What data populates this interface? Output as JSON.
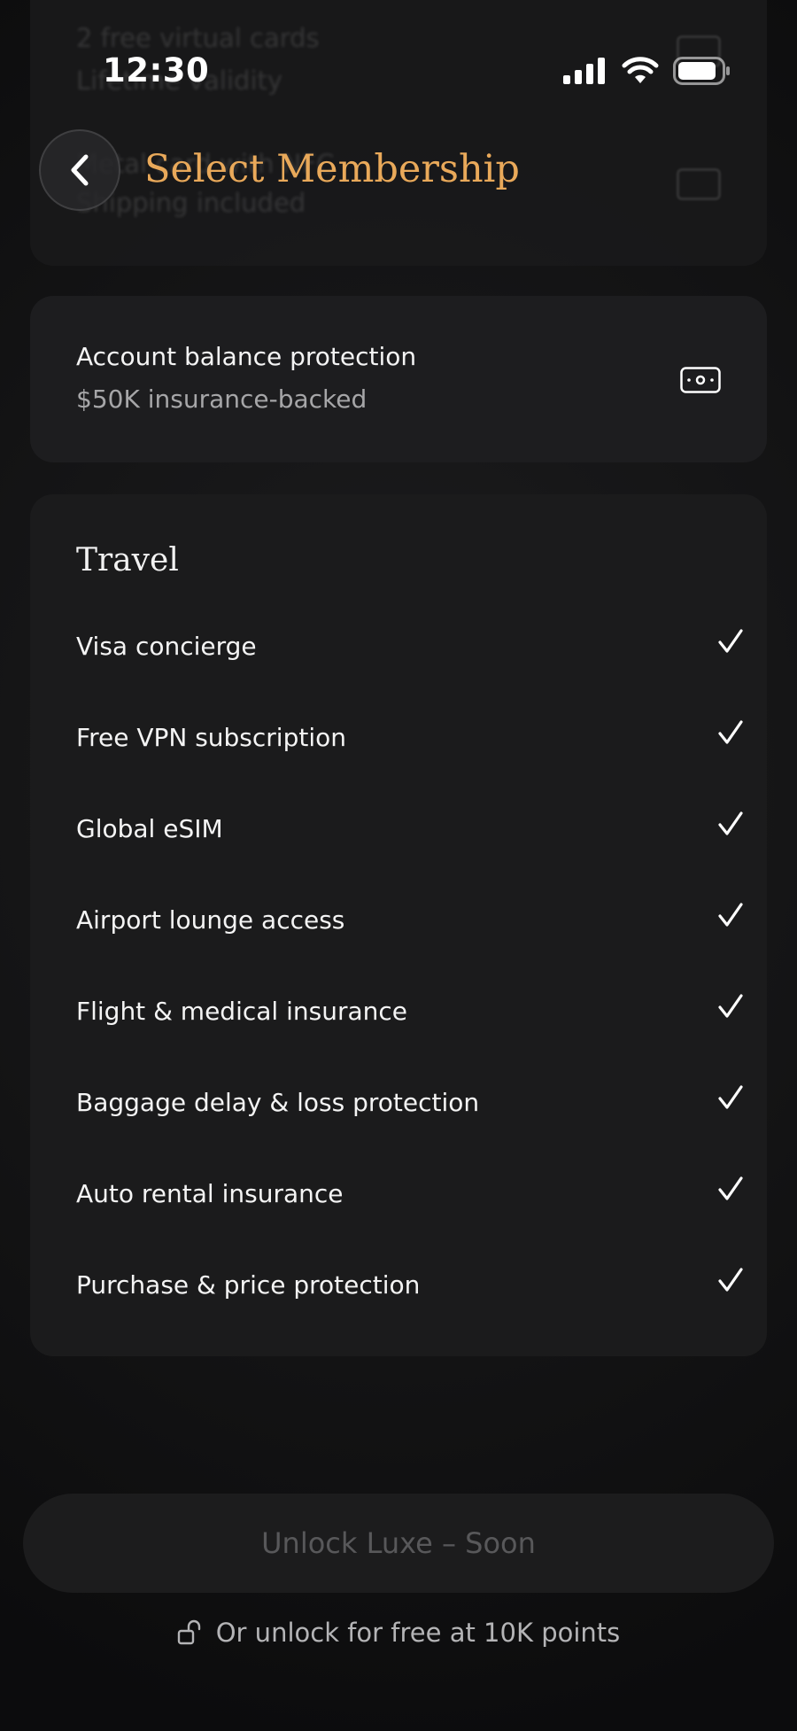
{
  "status_bar": {
    "time": "12:30"
  },
  "background_ghost": {
    "line1": "2 free virtual cards",
    "line2": "Lifetime validity",
    "line3": "Metal card with NFC",
    "line4": "Shipping included"
  },
  "header": {
    "title": "Select Membership",
    "title_color": "#e9a95a"
  },
  "balance_protection": {
    "title": "Account balance protection",
    "subtitle": "$50K insurance-backed",
    "icon": "cash-icon"
  },
  "travel": {
    "heading": "Travel",
    "items": [
      {
        "label": "Visa concierge",
        "included": true
      },
      {
        "label": "Free VPN subscription",
        "included": true
      },
      {
        "label": "Global eSIM",
        "included": true
      },
      {
        "label": "Airport lounge access",
        "included": true
      },
      {
        "label": "Flight & medical insurance",
        "included": true
      },
      {
        "label": "Baggage delay & loss protection",
        "included": true
      },
      {
        "label": "Auto rental insurance",
        "included": true
      },
      {
        "label": "Purchase & price protection",
        "included": true
      }
    ]
  },
  "footer": {
    "unlock_button_label": "Unlock Luxe – Soon",
    "free_unlock_text": "Or unlock for free at 10K points",
    "lock_icon": "unlock-icon"
  }
}
